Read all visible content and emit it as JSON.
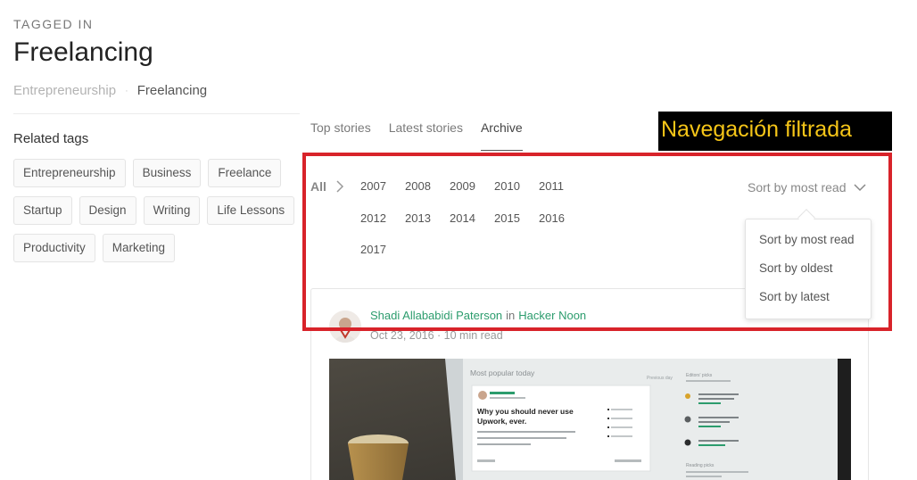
{
  "header": {
    "tagged_in": "TAGGED IN",
    "title": "Freelancing",
    "breadcrumb": {
      "parent": "Entrepreneurship",
      "separator": "·",
      "current": "Freelancing"
    }
  },
  "related": {
    "title": "Related tags",
    "rows": [
      [
        "Entrepreneurship",
        "Business",
        "Freelance"
      ],
      [
        "Startup",
        "Design",
        "Writing",
        "Life Lessons"
      ],
      [
        "Productivity",
        "Marketing"
      ]
    ]
  },
  "tabs": [
    "Top stories",
    "Latest stories",
    "Archive"
  ],
  "active_tab": "Archive",
  "annotation": "Navegación filtrada",
  "archive": {
    "all_label": "All",
    "years": [
      "2007",
      "2008",
      "2009",
      "2010",
      "2011",
      "2012",
      "2013",
      "2014",
      "2015",
      "2016",
      "2017"
    ]
  },
  "sort": {
    "current": "Sort by most read",
    "options": [
      "Sort by most read",
      "Sort by oldest",
      "Sort by latest"
    ]
  },
  "story": {
    "author": "Shadi Allababidi Paterson",
    "in": "in",
    "publication": "Hacker Noon",
    "meta": "Oct 23, 2016 · 10 min read",
    "image_screen": {
      "heading": "Most popular today",
      "previous_day": "Previous day",
      "headline_line1": "Why you should never use",
      "headline_line2": "Upwork, ever.",
      "editors_picks": "Editors' picks",
      "reading_picks": "Reading picks"
    }
  },
  "colors": {
    "accent_green": "#2c9c6d",
    "highlight_red": "#d8232a",
    "annotation_bg": "#000000",
    "annotation_text": "#f5c518"
  }
}
